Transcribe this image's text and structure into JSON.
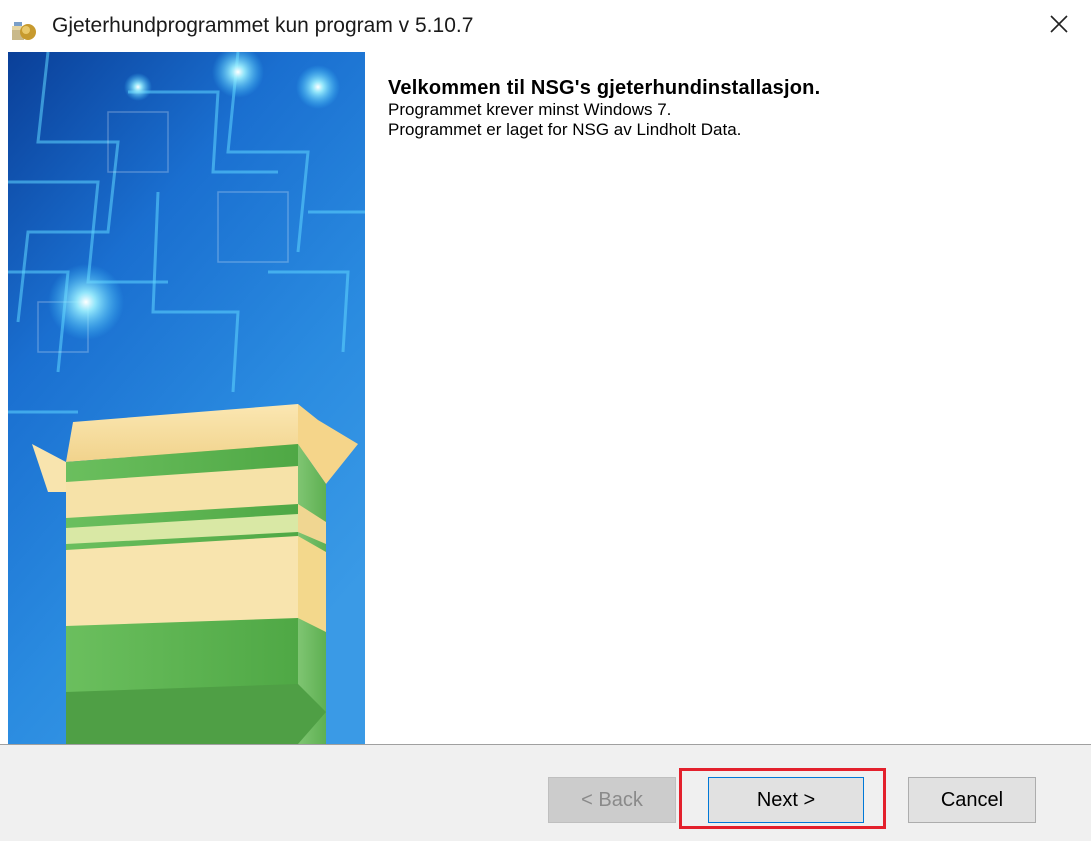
{
  "window": {
    "title": "Gjeterhundprogrammet kun program v 5.10.7",
    "app_icon": "installer-box-icon",
    "close_icon": "close-icon"
  },
  "banner": {
    "image": "installer-package-box-illustration",
    "colors": {
      "background": "#1f7fd8",
      "glow": "#7fe8ff",
      "box_top": "#f6dd9e",
      "box_green": "#57b04a"
    }
  },
  "content": {
    "heading": "Velkommen til NSG's gjeterhundinstallasjon.",
    "lines": [
      "Programmet krever minst Windows 7.",
      "Programmet er laget for NSG av Lindholt Data."
    ]
  },
  "buttons": {
    "back": "< Back",
    "next": "Next >",
    "cancel": "Cancel"
  },
  "colors": {
    "highlight": "#e3202c",
    "focus_border": "#0078d7",
    "footer_bg": "#f0f0f0"
  }
}
